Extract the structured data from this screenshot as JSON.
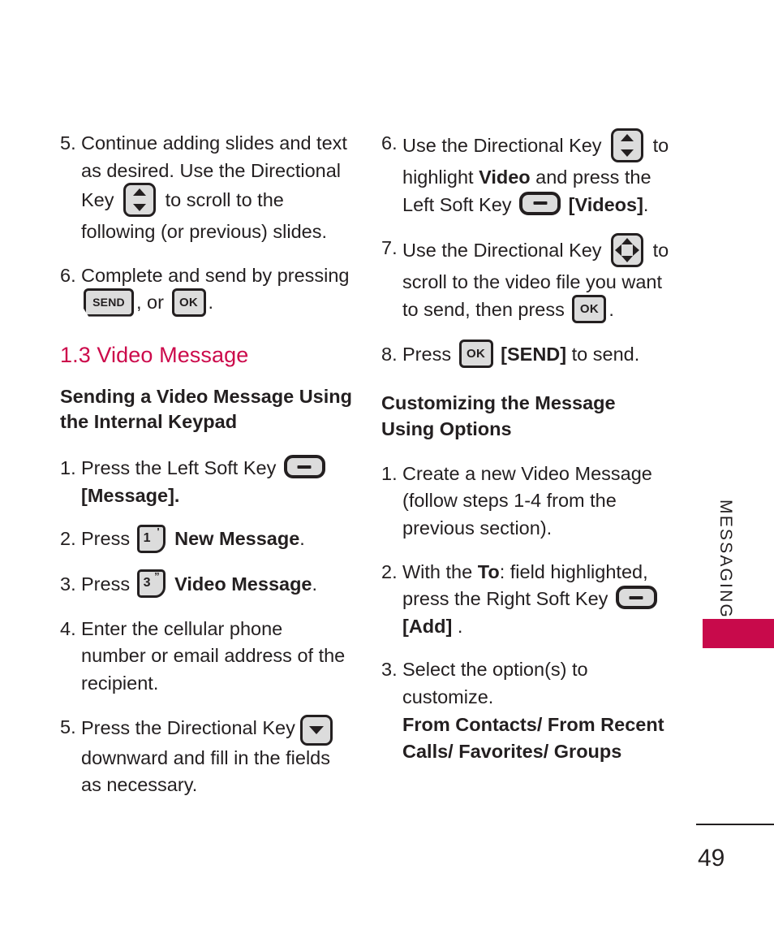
{
  "page": {
    "number": "49",
    "side_label": "MESSAGING"
  },
  "icons": {
    "dir_key_vertical": "directional-key-up-down-icon",
    "dir_key_four_way": "directional-key-four-way-icon",
    "dir_key_down": "directional-key-down-icon",
    "soft_key": "soft-key-icon",
    "ok_key": "ok-key-icon",
    "send_key": "send-key-icon",
    "num_key_1": "keypad-key-1-icon",
    "num_key_3": "keypad-key-3-icon"
  },
  "keys": {
    "ok_label": "OK",
    "send_label": "SEND",
    "num1_digit": "1",
    "num1_sup": "'",
    "num3_digit": "3",
    "num3_sup": "”"
  },
  "colors": {
    "heading": "#cc0a4b",
    "tab": "#c80a4b",
    "text": "#231f20",
    "key_fill": "#dcdcdc"
  },
  "left_column": {
    "steps": [
      {
        "num": "5.",
        "t1": "Continue adding slides and text as desired. Use the Directional Key",
        "t2": "to scroll to the following (or previous) slides."
      },
      {
        "num": "6.",
        "t1": "Complete and send by pressing",
        "t2": ", or",
        "t3": "."
      }
    ],
    "section_heading": "1.3 Video Message",
    "sub_heading": "Sending a Video Message Using the Internal Keypad",
    "numbered": [
      {
        "num": "1.",
        "t1": "Press the Left Soft Key",
        "t2": "[Message]."
      },
      {
        "num": "2.",
        "t1": "Press",
        "t2": "New Message",
        "t3": "."
      },
      {
        "num": "3.",
        "t1": "Press",
        "t2": "Video Message",
        "t3": "."
      },
      {
        "num": "4.",
        "t1": "Enter the cellular phone number or email address of the recipient."
      },
      {
        "num": "5.",
        "t1": "Press the Directional Key",
        "t2": "downward and fill in the fields as necessary."
      }
    ]
  },
  "right_column": {
    "steps": [
      {
        "num": "6.",
        "t1": "Use the Directional Key",
        "t2": "to highlight",
        "t3": "Video",
        "t4": "and press the Left Soft Key",
        "t5": "[Videos]",
        "t6": "."
      },
      {
        "num": "7.",
        "t1": "Use the Directional Key",
        "t2": "to scroll to the video file you want to send, then press",
        "t3": "."
      },
      {
        "num": "8.",
        "t1": "Press",
        "t2": "[SEND]",
        "t3": "to send."
      }
    ],
    "sub_heading": "Customizing the Message Using Options",
    "numbered": [
      {
        "num": "1.",
        "t1": "Create a new Video Message (follow steps 1-4 from the previous section)."
      },
      {
        "num": "2.",
        "t1": "With the",
        "t2": "To",
        "t3": ": field highlighted, press the Right Soft Key",
        "t4": "[Add]",
        "t5": " ."
      },
      {
        "num": "3.",
        "t1": "Select the option(s) to customize.",
        "t2": "From Contacts/ From Recent Calls/ Favorites/ Groups"
      }
    ]
  }
}
